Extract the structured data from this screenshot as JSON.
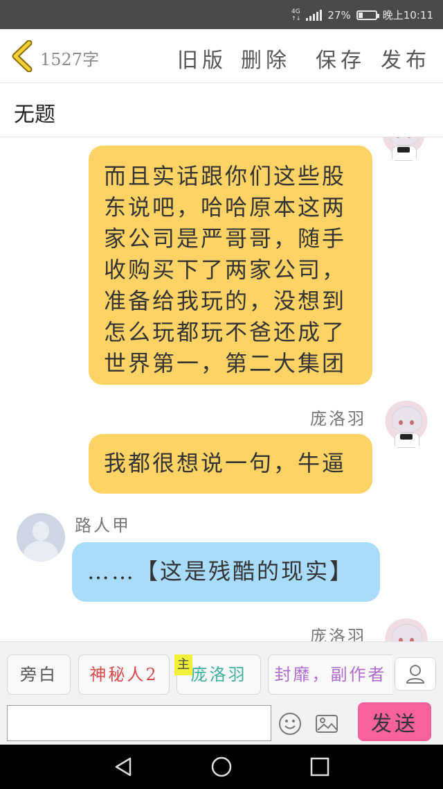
{
  "status_bar": {
    "network": "4G",
    "battery_percent": "27%",
    "battery_level": 0.27,
    "time": "晚上10:11"
  },
  "toolbar": {
    "word_count": "1527字",
    "old_version": "旧版",
    "delete": "删除",
    "save": "保存",
    "publish": "发布"
  },
  "title": "无题",
  "messages": [
    {
      "speaker": "",
      "text": "而且实话跟你们这些股东说吧，哈哈原本这两家公司是严哥哥，随手收购买下了两家公司，准备给我玩的，没想到怎么玩都玩不爸还成了世界第一，第二大集团"
    },
    {
      "speaker": "庞洛羽",
      "text": "我都很想说一句，牛逼"
    },
    {
      "speaker": "路人甲",
      "text": "……【这是残酷的现实】"
    },
    {
      "speaker": "庞洛羽",
      "text": ""
    }
  ],
  "characters": {
    "narration": "旁白",
    "mystery": "神秘人2",
    "host_tag": "主",
    "pang": "庞洛羽",
    "fengmi": "封靡，副作者"
  },
  "colors": {
    "self_bubble": "#fdd366",
    "other_bubble": "#a9dcfb",
    "send_button": "#f7629c",
    "mystery_text": "#d84a4a",
    "pang_text": "#3fb0a0",
    "fengmi_text": "#b06bd0"
  },
  "input": {
    "placeholder": "",
    "value": ""
  },
  "send_button": "发送",
  "icons": {
    "back": "back-chevron-icon",
    "emoji": "emoji-icon",
    "image": "image-icon",
    "user": "user-icon",
    "nav_back": "nav-back-icon",
    "nav_home": "nav-home-icon",
    "nav_recent": "nav-recent-icon"
  }
}
